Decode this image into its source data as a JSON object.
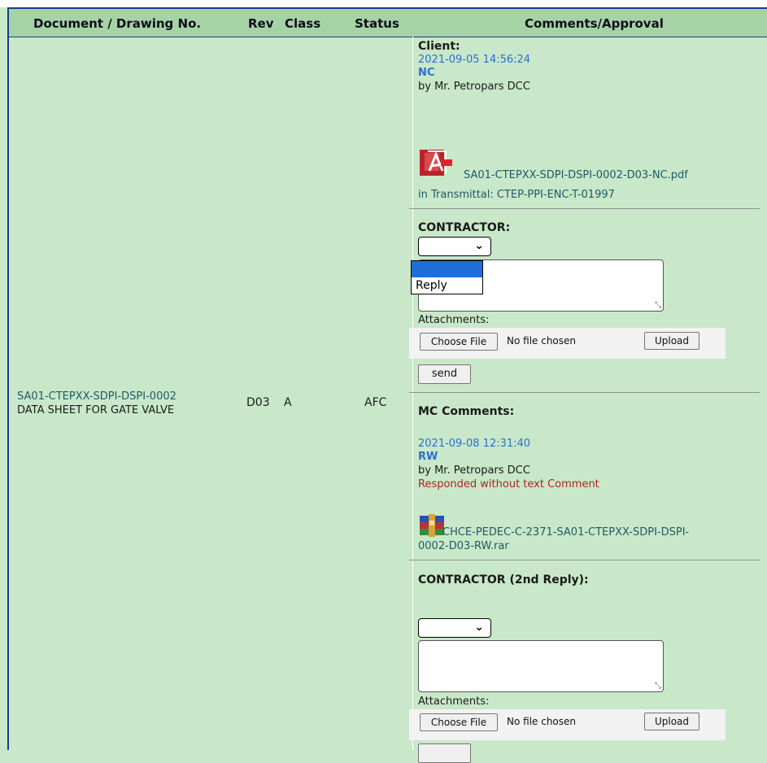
{
  "headers": {
    "doc": "Document / Drawing No.",
    "rev": "Rev",
    "class": "Class",
    "status": "Status",
    "comments": "Comments/Approval"
  },
  "row": {
    "doc_no": "SA01-CTEPXX-SDPI-DSPI-0002",
    "doc_title": "DATA SHEET FOR GATE VALVE",
    "rev": "D03",
    "class": "A",
    "status": "AFC"
  },
  "client": {
    "heading": "Client:",
    "datetime": "2021-09-05 14:56:24",
    "code": "NC",
    "by": "by Mr. Petropars DCC",
    "file": "SA01-CTEPXX-SDPI-DSPI-0002-D03-NC.pdf",
    "transmittal": "in Transmittal: CTEP-PPI-ENC-T-01997"
  },
  "contractor": {
    "heading": "CONTRACTOR:",
    "dropdown_options": [
      "",
      "Reply"
    ],
    "attachments_label": "Attachments:",
    "choose_file": "Choose File",
    "no_file": "No file chosen",
    "upload": "Upload",
    "send": "send"
  },
  "mc": {
    "heading": "MC Comments:",
    "datetime": "2021-09-08 12:31:40",
    "code": "RW",
    "by": "by Mr. Petropars DCC",
    "note": "Responded without text Comment",
    "file_line1": "CHCE-PEDEC-C-2371-SA01-CTEPXX-SDPI-DSPI-",
    "file_line2": "0002-D03-RW.rar"
  },
  "contractor2": {
    "heading": "CONTRACTOR (2nd Reply):",
    "attachments_label": "Attachments:",
    "choose_file": "Choose File",
    "no_file": "No file chosen",
    "upload": "Upload"
  },
  "colors": {
    "background": "#c9e8c9",
    "header_bg": "#a6d3a6",
    "border": "#1b3b8f",
    "date_blue": "#2a6fd1",
    "link_teal": "#1d5a67",
    "note_red": "#b22222"
  },
  "icons": [
    "pdf-icon",
    "rar-archive-icon",
    "chevron-down-icon"
  ]
}
